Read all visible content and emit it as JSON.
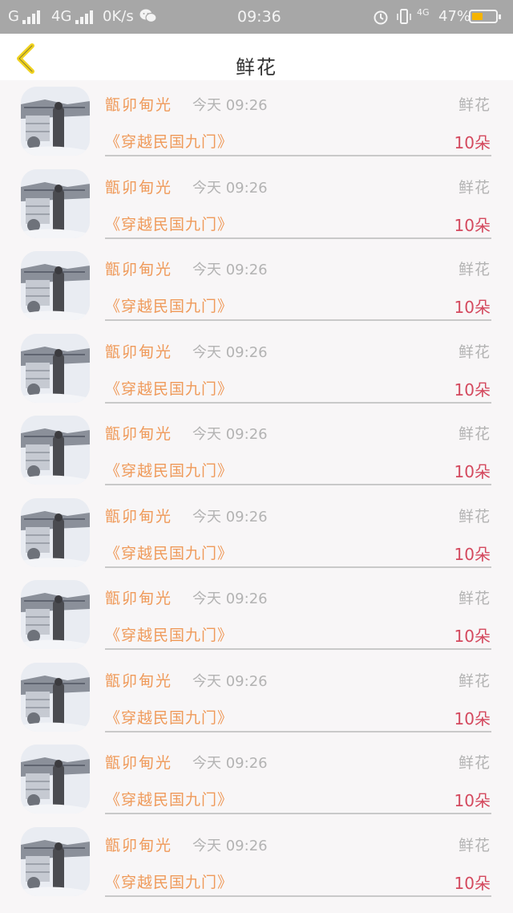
{
  "status_bar": {
    "network_left": "G",
    "network_right": "4G",
    "speed": "0K/s",
    "time": "09:36",
    "net_badge": "4G",
    "battery_text": "47%",
    "battery_level": 0.47
  },
  "header": {
    "title": "鲜花"
  },
  "items": [
    {
      "name": "甑卯甸光",
      "time": "今天 09:26",
      "type": "鲜花",
      "book": "《穿越民国九门》",
      "amount": "10朵"
    },
    {
      "name": "甑卯甸光",
      "time": "今天 09:26",
      "type": "鲜花",
      "book": "《穿越民国九门》",
      "amount": "10朵"
    },
    {
      "name": "甑卯甸光",
      "time": "今天 09:26",
      "type": "鲜花",
      "book": "《穿越民国九门》",
      "amount": "10朵"
    },
    {
      "name": "甑卯甸光",
      "time": "今天 09:26",
      "type": "鲜花",
      "book": "《穿越民国九门》",
      "amount": "10朵"
    },
    {
      "name": "甑卯甸光",
      "time": "今天 09:26",
      "type": "鲜花",
      "book": "《穿越民国九门》",
      "amount": "10朵"
    },
    {
      "name": "甑卯甸光",
      "time": "今天 09:26",
      "type": "鲜花",
      "book": "《穿越民国九门》",
      "amount": "10朵"
    },
    {
      "name": "甑卯甸光",
      "time": "今天 09:26",
      "type": "鲜花",
      "book": "《穿越民国九门》",
      "amount": "10朵"
    },
    {
      "name": "甑卯甸光",
      "time": "今天 09:26",
      "type": "鲜花",
      "book": "《穿越民国九门》",
      "amount": "10朵"
    },
    {
      "name": "甑卯甸光",
      "time": "今天 09:26",
      "type": "鲜花",
      "book": "《穿越民国九门》",
      "amount": "10朵"
    },
    {
      "name": "甑卯甸光",
      "time": "今天 09:26",
      "type": "鲜花",
      "book": "《穿越民国九门》",
      "amount": "10朵"
    }
  ],
  "colors": {
    "accent_orange": "#ef9a5a",
    "amount_red": "#d4495e",
    "back_yellow": "#f0d21e",
    "battery_yellow": "#f5b400"
  }
}
